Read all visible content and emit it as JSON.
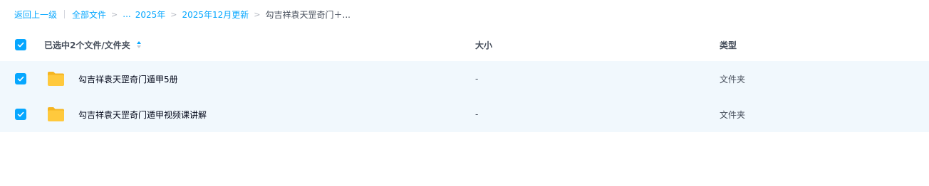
{
  "breadcrumb": {
    "back_label": "返回上一级",
    "root_label": "全部文件",
    "ellipsis": "...",
    "items": [
      "2025年",
      "2025年12月更新"
    ],
    "current": "勾吉祥袁天罡奇门＋..."
  },
  "table": {
    "header": {
      "selection_label": "已选中2个文件/文件夹",
      "size_label": "大小",
      "type_label": "类型"
    },
    "rows": [
      {
        "name": "勾吉祥袁天罡奇门遁甲5册",
        "size": "-",
        "type": "文件夹",
        "checked": true
      },
      {
        "name": "勾吉祥袁天罡奇门遁甲视频课讲解",
        "size": "-",
        "type": "文件夹",
        "checked": true
      }
    ]
  },
  "colors": {
    "accent": "#06a7ff",
    "selected_row_bg": "#f1f8fd",
    "folder": "#ffc93d"
  },
  "icons": {
    "checkbox": "check-icon",
    "sort": "sort-icon",
    "folder": "folder-icon",
    "chevron": "chevron-right-icon"
  }
}
